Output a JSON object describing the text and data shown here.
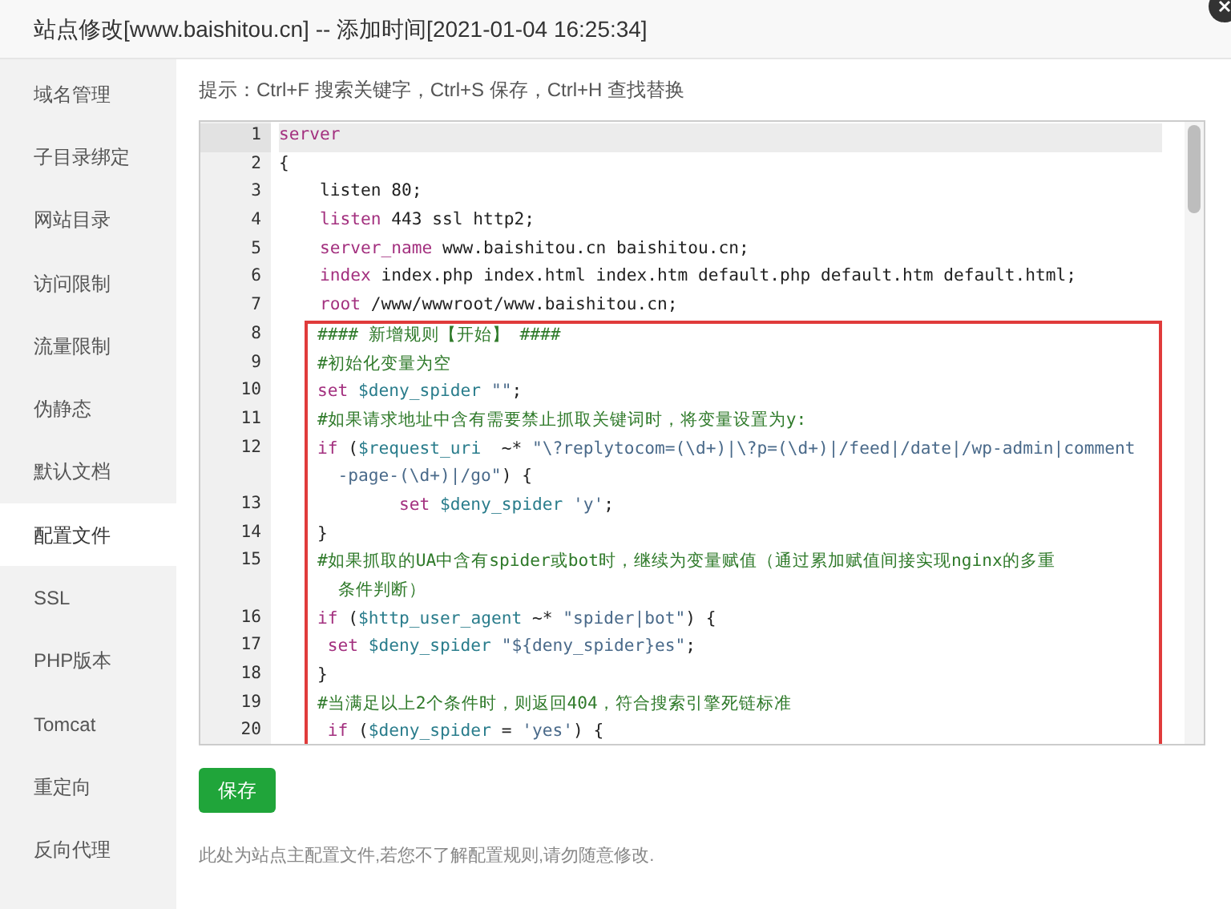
{
  "window": {
    "title": "站点修改[www.baishitou.cn] -- 添加时间[2021-01-04 16:25:34]"
  },
  "sidebar": {
    "items": [
      {
        "label": "域名管理",
        "selected": false
      },
      {
        "label": "子目录绑定",
        "selected": false
      },
      {
        "label": "网站目录",
        "selected": false
      },
      {
        "label": "访问限制",
        "selected": false
      },
      {
        "label": "流量限制",
        "selected": false
      },
      {
        "label": "伪静态",
        "selected": false
      },
      {
        "label": "默认文档",
        "selected": false
      },
      {
        "label": "配置文件",
        "selected": true
      },
      {
        "label": "SSL",
        "selected": false
      },
      {
        "label": "PHP版本",
        "selected": false
      },
      {
        "label": "Tomcat",
        "selected": false
      },
      {
        "label": "重定向",
        "selected": false
      },
      {
        "label": "反向代理",
        "selected": false
      }
    ]
  },
  "hint": "提示：Ctrl+F 搜索关键字，Ctrl+S 保存，Ctrl+H 查找替换",
  "editor": {
    "lines": [
      {
        "number": "1",
        "active": true,
        "highlighted": false,
        "tokens": [
          {
            "text": "server",
            "kind": "keyword"
          }
        ]
      },
      {
        "number": "2",
        "active": false,
        "highlighted": false,
        "tokens": [
          {
            "text": "{",
            "kind": "plain"
          }
        ]
      },
      {
        "number": "3",
        "active": false,
        "highlighted": false,
        "tokens": [
          {
            "text": "    listen 80;",
            "kind": "plain"
          }
        ]
      },
      {
        "number": "4",
        "active": false,
        "highlighted": false,
        "tokens": [
          {
            "text": "    listen",
            "kind": "keyword"
          },
          {
            "text": " 443 ssl http2;",
            "kind": "plain"
          }
        ]
      },
      {
        "number": "5",
        "active": false,
        "highlighted": false,
        "tokens": [
          {
            "text": "    server_name",
            "kind": "keyword"
          },
          {
            "text": " www.baishitou.cn baishitou.cn;",
            "kind": "plain"
          }
        ]
      },
      {
        "number": "6",
        "active": false,
        "highlighted": false,
        "tokens": [
          {
            "text": "    index",
            "kind": "keyword"
          },
          {
            "text": " index.php index.html index.htm default.php default.htm default.html;",
            "kind": "plain"
          }
        ]
      },
      {
        "number": "7",
        "active": false,
        "highlighted": false,
        "tokens": [
          {
            "text": "    root",
            "kind": "keyword"
          },
          {
            "text": " /www/wwwroot/www.baishitou.cn;",
            "kind": "plain"
          }
        ]
      },
      {
        "number": "8",
        "active": false,
        "highlighted": true,
        "tokens": [
          {
            "text": "#### 新增规则【开始】 ####",
            "kind": "comment"
          }
        ]
      },
      {
        "number": "9",
        "active": false,
        "highlighted": true,
        "tokens": [
          {
            "text": "#初始化变量为空",
            "kind": "comment"
          }
        ]
      },
      {
        "number": "10",
        "active": false,
        "highlighted": true,
        "tokens": [
          {
            "text": "set",
            "kind": "keyword"
          },
          {
            "text": " $deny_spider",
            "kind": "variable"
          },
          {
            "text": " \"\"",
            "kind": "string"
          },
          {
            "text": ";",
            "kind": "plain"
          }
        ]
      },
      {
        "number": "11",
        "active": false,
        "highlighted": true,
        "tokens": [
          {
            "text": "#如果请求地址中含有需要禁止抓取关键词时，将变量设置为y:",
            "kind": "comment"
          }
        ]
      },
      {
        "number": "12",
        "active": false,
        "highlighted": true,
        "tokens": [
          {
            "text": "if",
            "kind": "keyword"
          },
          {
            "text": " (",
            "kind": "plain"
          },
          {
            "text": "$request_uri",
            "kind": "variable"
          },
          {
            "text": "  ~* ",
            "kind": "plain"
          },
          {
            "text": "\"\\?replytocom=(\\d+)|\\?p=(\\d+)|/feed|/date|/wp-admin|comment",
            "kind": "string"
          }
        ],
        "continuation": [
          {
            "text": "  -page-(\\d+)|/go\"",
            "kind": "string"
          },
          {
            "text": ") {",
            "kind": "plain"
          }
        ]
      },
      {
        "number": "13",
        "active": false,
        "highlighted": true,
        "tokens": [
          {
            "text": "        set",
            "kind": "keyword"
          },
          {
            "text": " $deny_spider",
            "kind": "variable"
          },
          {
            "text": " 'y'",
            "kind": "string"
          },
          {
            "text": ";",
            "kind": "plain"
          }
        ]
      },
      {
        "number": "14",
        "active": false,
        "highlighted": true,
        "tokens": [
          {
            "text": "}",
            "kind": "plain"
          }
        ]
      },
      {
        "number": "15",
        "active": false,
        "highlighted": true,
        "tokens": [
          {
            "text": "#如果抓取的UA中含有spider或bot时，继续为变量赋值（通过累加赋值间接实现nginx的多重",
            "kind": "comment"
          }
        ],
        "continuation": [
          {
            "text": "  条件判断）",
            "kind": "comment"
          }
        ]
      },
      {
        "number": "16",
        "active": false,
        "highlighted": true,
        "tokens": [
          {
            "text": "if",
            "kind": "keyword"
          },
          {
            "text": " (",
            "kind": "plain"
          },
          {
            "text": "$http_user_agent",
            "kind": "variable"
          },
          {
            "text": " ~* ",
            "kind": "plain"
          },
          {
            "text": "\"spider|bot\"",
            "kind": "string"
          },
          {
            "text": ") {",
            "kind": "plain"
          }
        ]
      },
      {
        "number": "17",
        "active": false,
        "highlighted": true,
        "tokens": [
          {
            "text": " set",
            "kind": "keyword"
          },
          {
            "text": " $deny_spider",
            "kind": "variable"
          },
          {
            "text": " \"${deny_spider}es\"",
            "kind": "string"
          },
          {
            "text": ";",
            "kind": "plain"
          }
        ]
      },
      {
        "number": "18",
        "active": false,
        "highlighted": true,
        "tokens": [
          {
            "text": "}",
            "kind": "plain"
          }
        ]
      },
      {
        "number": "19",
        "active": false,
        "highlighted": true,
        "tokens": [
          {
            "text": "#当满足以上2个条件时，则返回404，符合搜索引擎死链标准",
            "kind": "comment"
          }
        ]
      },
      {
        "number": "20",
        "active": false,
        "highlighted": true,
        "tokens": [
          {
            "text": " if",
            "kind": "keyword"
          },
          {
            "text": " (",
            "kind": "plain"
          },
          {
            "text": "$deny_spider",
            "kind": "variable"
          },
          {
            "text": " = ",
            "kind": "plain"
          },
          {
            "text": "'yes'",
            "kind": "string"
          },
          {
            "text": ") {",
            "kind": "plain"
          }
        ]
      }
    ]
  },
  "save_button": "保存",
  "note": "此处为站点主配置文件,若您不了解配置规则,请勿随意修改."
}
